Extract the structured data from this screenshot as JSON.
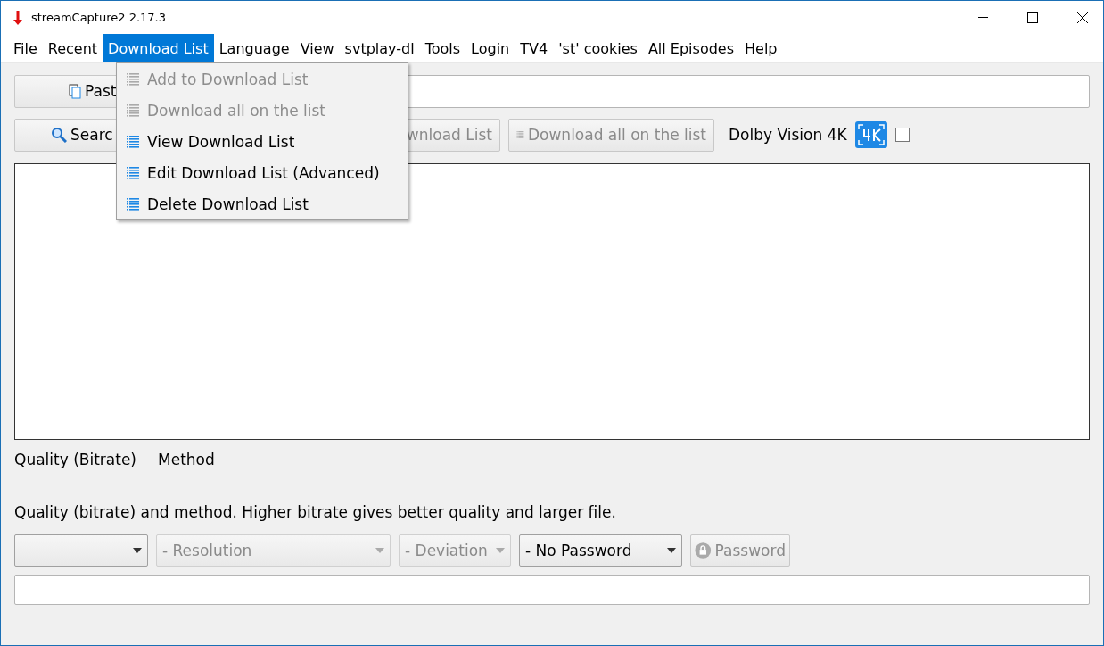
{
  "window": {
    "title": "streamCapture2 2.17.3"
  },
  "menu_bar": [
    {
      "label": "File",
      "selected": false
    },
    {
      "label": "Recent",
      "selected": false
    },
    {
      "label": "Download List",
      "selected": true
    },
    {
      "label": "Language",
      "selected": false
    },
    {
      "label": "View",
      "selected": false
    },
    {
      "label": "svtplay-dl",
      "selected": false
    },
    {
      "label": "Tools",
      "selected": false
    },
    {
      "label": "Login",
      "selected": false
    },
    {
      "label": "TV4",
      "selected": false
    },
    {
      "label": "'st' cookies",
      "selected": false
    },
    {
      "label": "All Episodes",
      "selected": false
    },
    {
      "label": "Help",
      "selected": false
    }
  ],
  "dropdown_menu": {
    "items": [
      {
        "label": "Add to Download List",
        "disabled": true
      },
      {
        "label": "Download all on the list",
        "disabled": true
      },
      {
        "label": "View Download List",
        "disabled": false
      },
      {
        "label": "Edit Download List (Advanced)",
        "disabled": false
      },
      {
        "label": "Delete Download List",
        "disabled": false
      }
    ]
  },
  "toolbar_1": {
    "paste_button": {
      "label": "Past"
    }
  },
  "toolbar_2": {
    "search_button": {
      "label": "Searc"
    },
    "add_button": {
      "label": "wnload List",
      "disabled": true
    },
    "download_all_button": {
      "label": "Download all on the list",
      "disabled": true
    },
    "dolby_label": "Dolby Vision 4K",
    "dolby_checkbox": {
      "checked": false
    }
  },
  "labels": {
    "quality": "Quality (Bitrate)",
    "method": "Method",
    "hint": "Quality (bitrate) and method. Higher bitrate gives better quality and larger file."
  },
  "bottom_controls": {
    "selects": [
      {
        "disabled": false
      },
      {
        "value": "- Resolution",
        "disabled": true
      },
      {
        "value": "- Deviation",
        "disabled": true
      },
      {
        "value": "- No Password",
        "disabled": false
      }
    ],
    "password_button": {
      "label": "Password",
      "disabled": true
    }
  }
}
